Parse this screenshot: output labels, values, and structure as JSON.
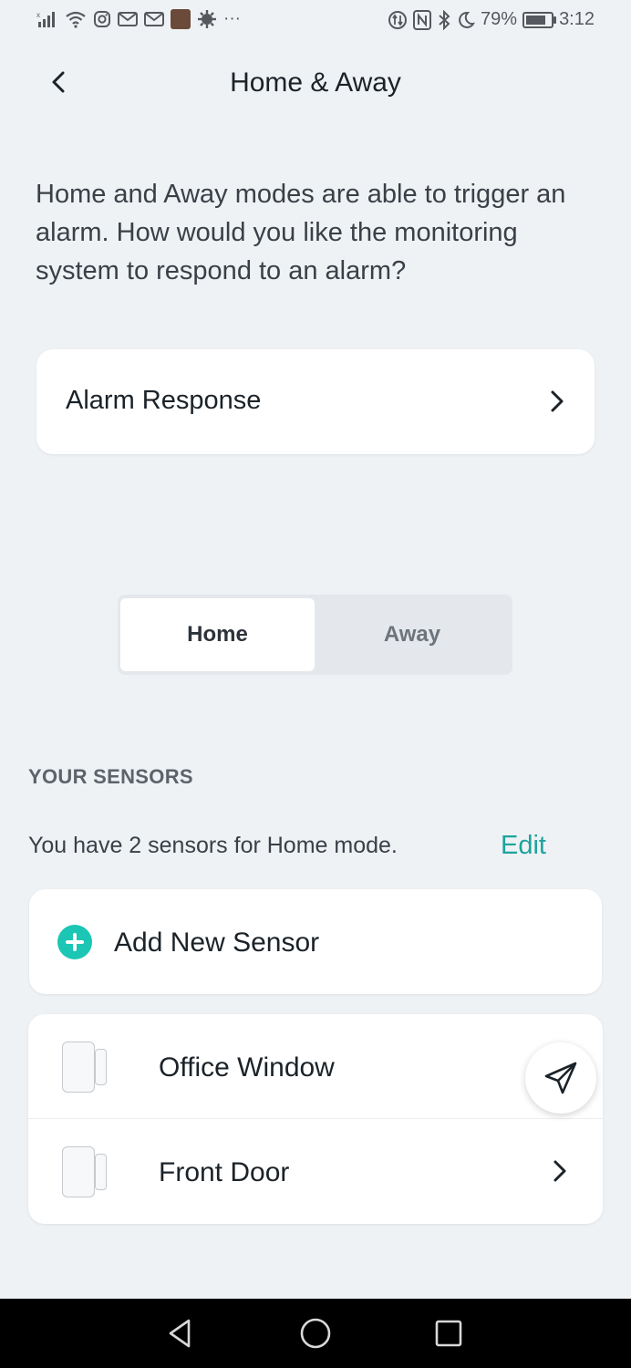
{
  "status_bar": {
    "left_icons": [
      "signal-x-icon",
      "wifi-icon",
      "instagram-icon",
      "gmail-icon",
      "gmail-icon",
      "avatar-notification",
      "settings-notification-icon",
      "more-icon"
    ],
    "more": "···",
    "right_icons": [
      "data-icon",
      "nfc-icon",
      "bluetooth-icon",
      "moon-icon"
    ],
    "battery": "79%",
    "battery_level": 0.79,
    "time": "3:12"
  },
  "header": {
    "back_icon": "chevron-left-icon",
    "title": "Home & Away"
  },
  "intro_text": "Home and Away modes are able to trigger an alarm. How would you like the monitoring system to respond to an alarm?",
  "alarm_response": {
    "label": "Alarm Response",
    "icon": "chevron-right-icon"
  },
  "mode_toggle": {
    "options": [
      "Home",
      "Away"
    ],
    "selected": "Home"
  },
  "sensors_section": {
    "title": "YOUR SENSORS",
    "summary": "You have 2 sensors for Home mode.",
    "edit_label": "Edit",
    "add_label": "Add New Sensor",
    "sensors": [
      {
        "name": "Office Window",
        "icon": "contact-sensor-icon"
      },
      {
        "name": "Front Door",
        "icon": "contact-sensor-icon"
      }
    ]
  },
  "fab": {
    "icon": "paper-plane-icon"
  },
  "nav_bar": {
    "buttons": [
      "back-triangle-icon",
      "home-circle-icon",
      "recents-square-icon"
    ]
  },
  "colors": {
    "background": "#eff2f5",
    "accent": "#1ea39c",
    "plus_accent": "#1bc6b4",
    "card": "#ffffff"
  }
}
